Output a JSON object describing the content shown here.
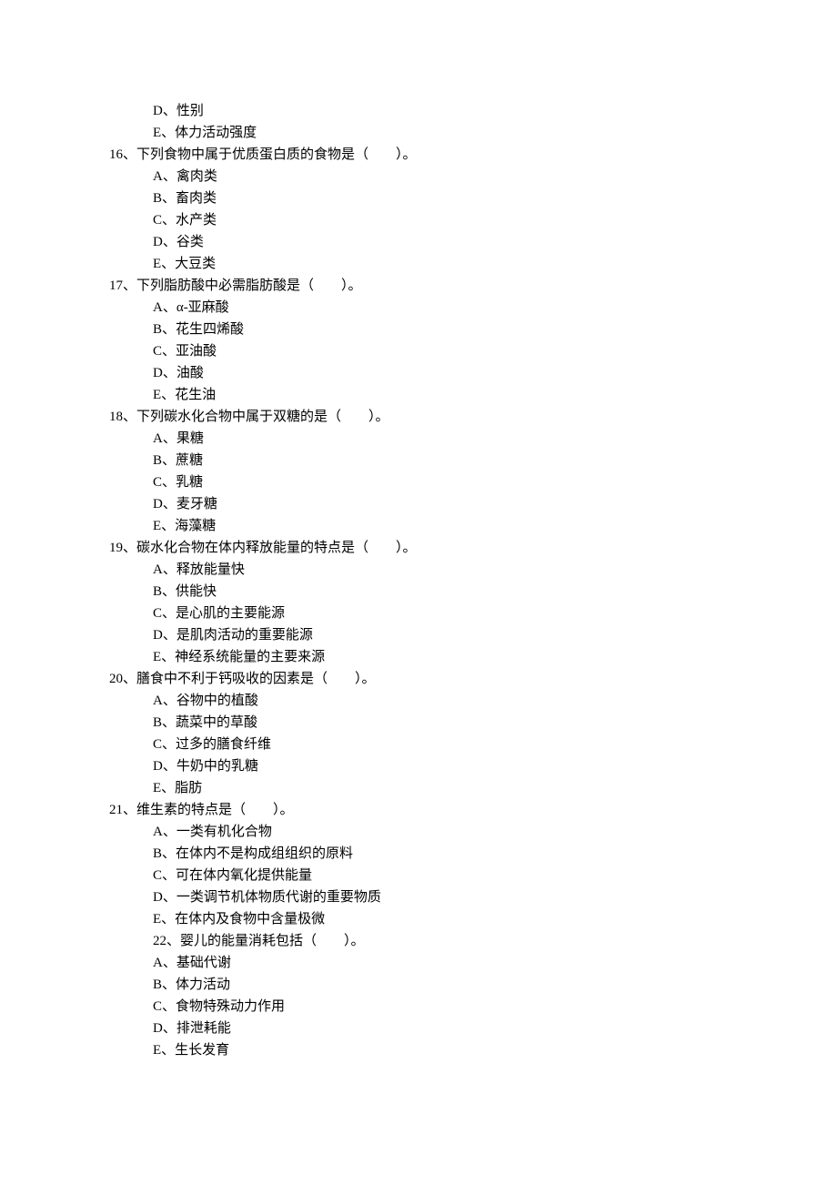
{
  "lines": [
    {
      "cls": "option-row",
      "text": "D、性别"
    },
    {
      "cls": "option-row",
      "text": "E、体力活动强度"
    },
    {
      "cls": "question-row",
      "text": "16、下列食物中属于优质蛋白质的食物是（　　）。"
    },
    {
      "cls": "option-row",
      "text": "A、禽肉类"
    },
    {
      "cls": "option-row",
      "text": "B、畜肉类"
    },
    {
      "cls": "option-row",
      "text": "C、水产类"
    },
    {
      "cls": "option-row",
      "text": "D、谷类"
    },
    {
      "cls": "option-row",
      "text": "E、大豆类"
    },
    {
      "cls": "question-row",
      "text": "17、下列脂肪酸中必需脂肪酸是（　　）。"
    },
    {
      "cls": "option-row",
      "text": "A、α-亚麻酸"
    },
    {
      "cls": "option-row",
      "text": "B、花生四烯酸"
    },
    {
      "cls": "option-row",
      "text": "C、亚油酸"
    },
    {
      "cls": "option-row",
      "text": "D、油酸"
    },
    {
      "cls": "option-row",
      "text": "E、花生油"
    },
    {
      "cls": "question-row",
      "text": "18、下列碳水化合物中属于双糖的是（　　）。"
    },
    {
      "cls": "option-row",
      "text": "A、果糖"
    },
    {
      "cls": "option-row",
      "text": "B、蔗糖"
    },
    {
      "cls": "option-row",
      "text": "C、乳糖"
    },
    {
      "cls": "option-row",
      "text": "D、麦牙糖"
    },
    {
      "cls": "option-row",
      "text": "E、海藻糖"
    },
    {
      "cls": "question-row",
      "text": "19、碳水化合物在体内释放能量的特点是（　　）。"
    },
    {
      "cls": "option-row",
      "text": "A、释放能量快"
    },
    {
      "cls": "option-row",
      "text": "B、供能快"
    },
    {
      "cls": "option-row",
      "text": "C、是心肌的主要能源"
    },
    {
      "cls": "option-row",
      "text": "D、是肌肉活动的重要能源"
    },
    {
      "cls": "option-row",
      "text": "E、神经系统能量的主要来源"
    },
    {
      "cls": "question-row",
      "text": "20、膳食中不利于钙吸收的因素是（　　）。"
    },
    {
      "cls": "option-row",
      "text": "A、谷物中的植酸"
    },
    {
      "cls": "option-row",
      "text": "B、蔬菜中的草酸"
    },
    {
      "cls": "option-row",
      "text": "C、过多的膳食纤维"
    },
    {
      "cls": "option-row",
      "text": "D、牛奶中的乳糖"
    },
    {
      "cls": "option-row",
      "text": "E、脂肪"
    },
    {
      "cls": "question-row",
      "text": "21、维生素的特点是（　　）。"
    },
    {
      "cls": "option-row",
      "text": "A、一类有机化合物"
    },
    {
      "cls": "option-row",
      "text": "B、在体内不是构成组组织的原料"
    },
    {
      "cls": "option-row",
      "text": "C、可在体内氧化提供能量"
    },
    {
      "cls": "option-row",
      "text": "D、一类调节机体物质代谢的重要物质"
    },
    {
      "cls": "option-row",
      "text": "E、在体内及食物中含量极微"
    },
    {
      "cls": "q22",
      "text": "22、婴儿的能量消耗包括（　　）。"
    },
    {
      "cls": "option-row",
      "text": "A、基础代谢"
    },
    {
      "cls": "option-row",
      "text": "B、体力活动"
    },
    {
      "cls": "option-row",
      "text": "C、食物特殊动力作用"
    },
    {
      "cls": "option-row",
      "text": "D、排泄耗能"
    },
    {
      "cls": "option-row",
      "text": "E、生长发育"
    }
  ]
}
